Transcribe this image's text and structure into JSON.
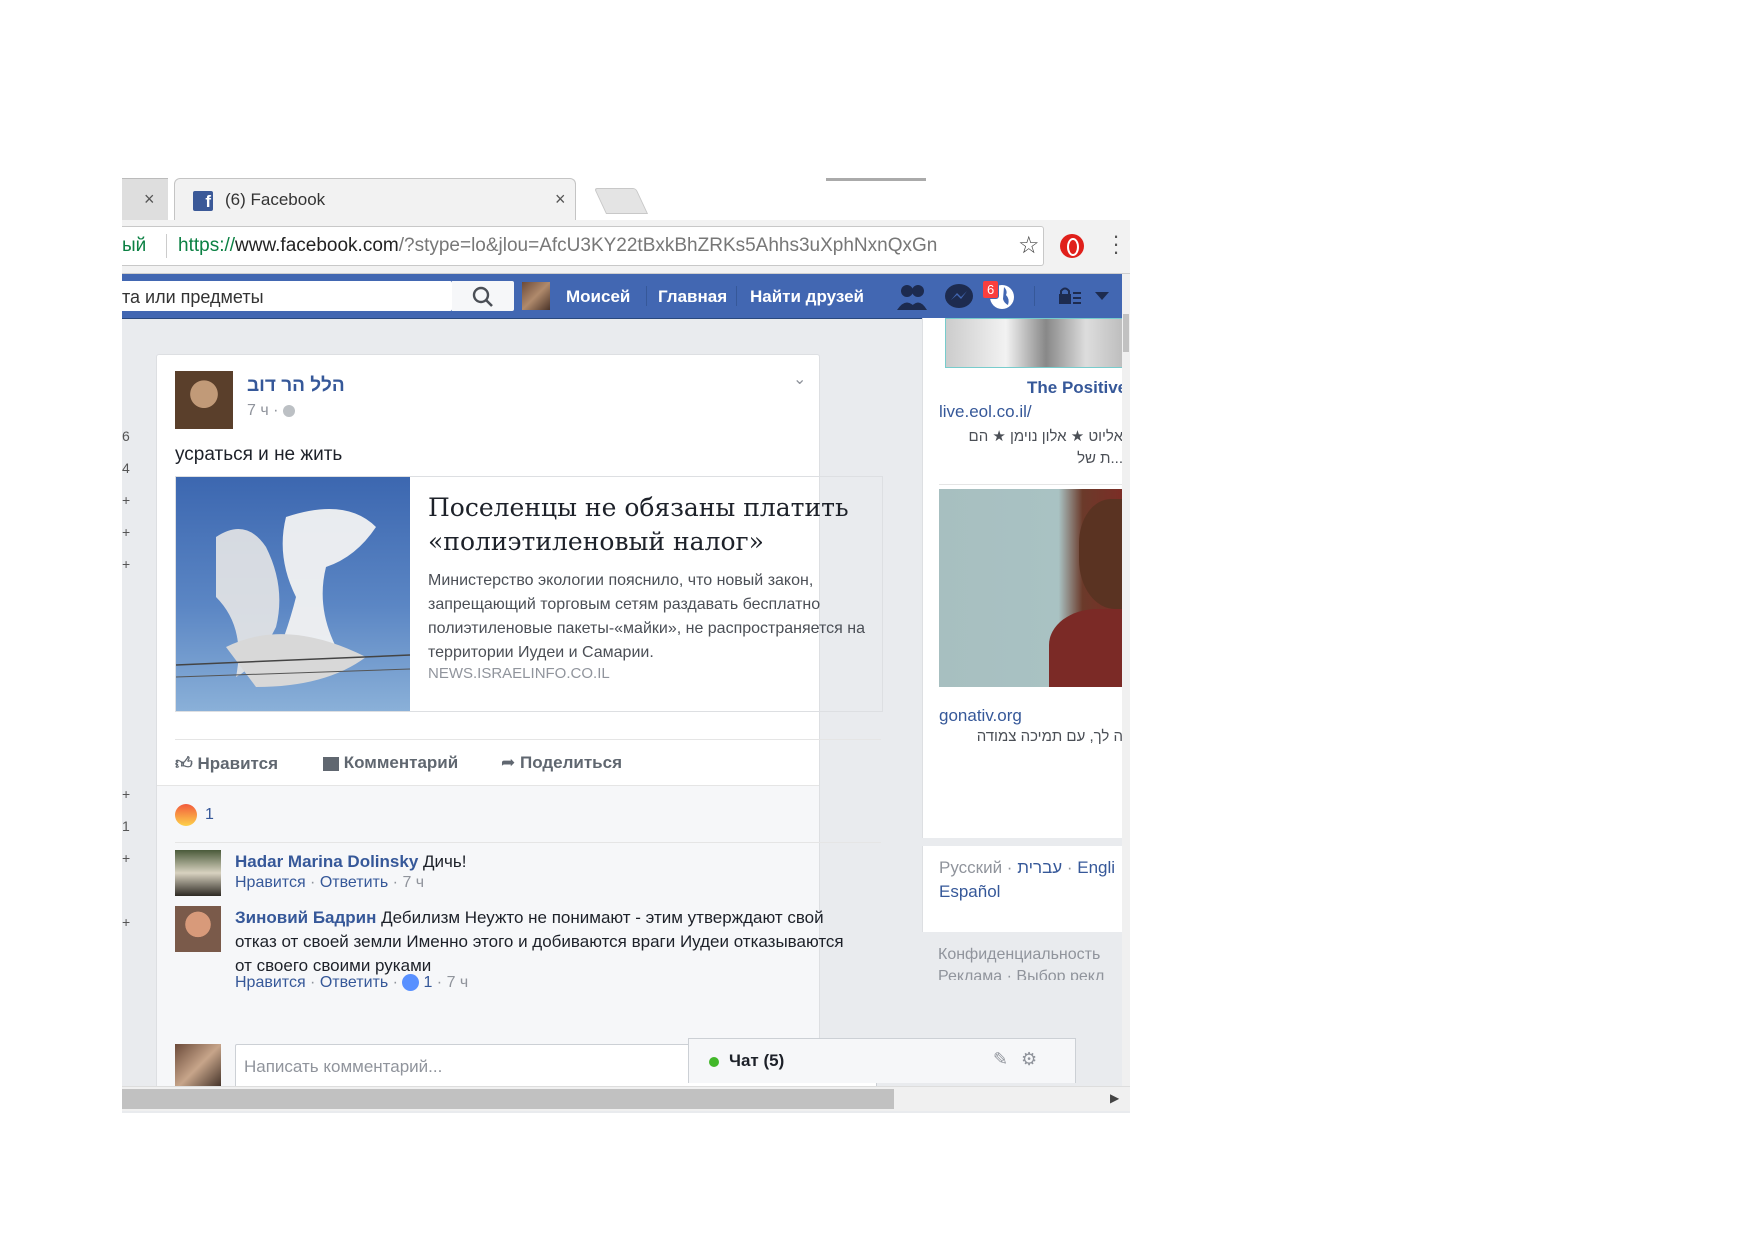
{
  "browser": {
    "tab_active_title": "(6) Facebook",
    "tab_close": "×",
    "url_prefix_fragment": "ый",
    "url_scheme": "https://",
    "url_host": "www.facebook.com",
    "url_path": "/?stype=lo&jlou=AfcU3KY22tBxkBhZRKs5Ahhs3uXphNxnQxGn"
  },
  "fbbar": {
    "search_placeholder": "та или предметы",
    "profile_name": "Моисей",
    "home": "Главная",
    "find_friends": "Найти друзей",
    "notifications_count": "6",
    "brand_color": "#4267b2"
  },
  "left_edge_numbers": [
    "6",
    "4",
    "+",
    "+",
    "+",
    "+",
    "1",
    "+",
    "+"
  ],
  "post": {
    "author": "הלל הר דוב",
    "time": "7 ч ·",
    "text": "усраться и не жить",
    "link": {
      "title": "Поселенцы не обязаны платить «полиэтиленовый налог»",
      "description": "Министерство экологии пояснило, что новый закон, запрещающий торговым сетям раздавать бесплатно полиэтиленовые пакеты-«майки», не распространяется на территории Иудеи и Самарии.",
      "source": "NEWS.ISRAELINFO.CO.IL"
    },
    "actions": {
      "like": "Нравится",
      "comment": "Комментарий",
      "share": "Поделиться"
    },
    "reactions_count": "1",
    "comments": [
      {
        "author": "Hadar Marina Dolinsky",
        "text": "Дичь!",
        "like": "Нравится",
        "reply": "Ответить",
        "time": "7 ч",
        "likes": ""
      },
      {
        "author": "Зиновий Бадрин",
        "text": "Дебилизм Неужто не понимают - этим утверждают свой отказ от своей земли Именно этого и добиваются враги Иудеи отказываются от своего своими руками",
        "like": "Нравится",
        "reply": "Ответить",
        "time": "7 ч",
        "likes": "1"
      }
    ],
    "write_placeholder": "Написать комментарий..."
  },
  "right": {
    "ad1_title": "The Positive",
    "ad1_link": "live.eol.co.il/",
    "ad1_text_line1": "אליוט ★ אלון נוימן ★ הם",
    "ad1_text_line2": "...ת של",
    "ad2_link": "gonativ.org",
    "ad2_text": "ה לך, עם תמיכה צמודה",
    "lang_ru": "Русский",
    "lang_he": "עברית",
    "lang_en": "Engli",
    "lang_es": "Español",
    "footer1": "Конфиденциальность",
    "footer2": "Реклама · Выбор рекл"
  },
  "chat": {
    "label": "Чат (5)"
  }
}
